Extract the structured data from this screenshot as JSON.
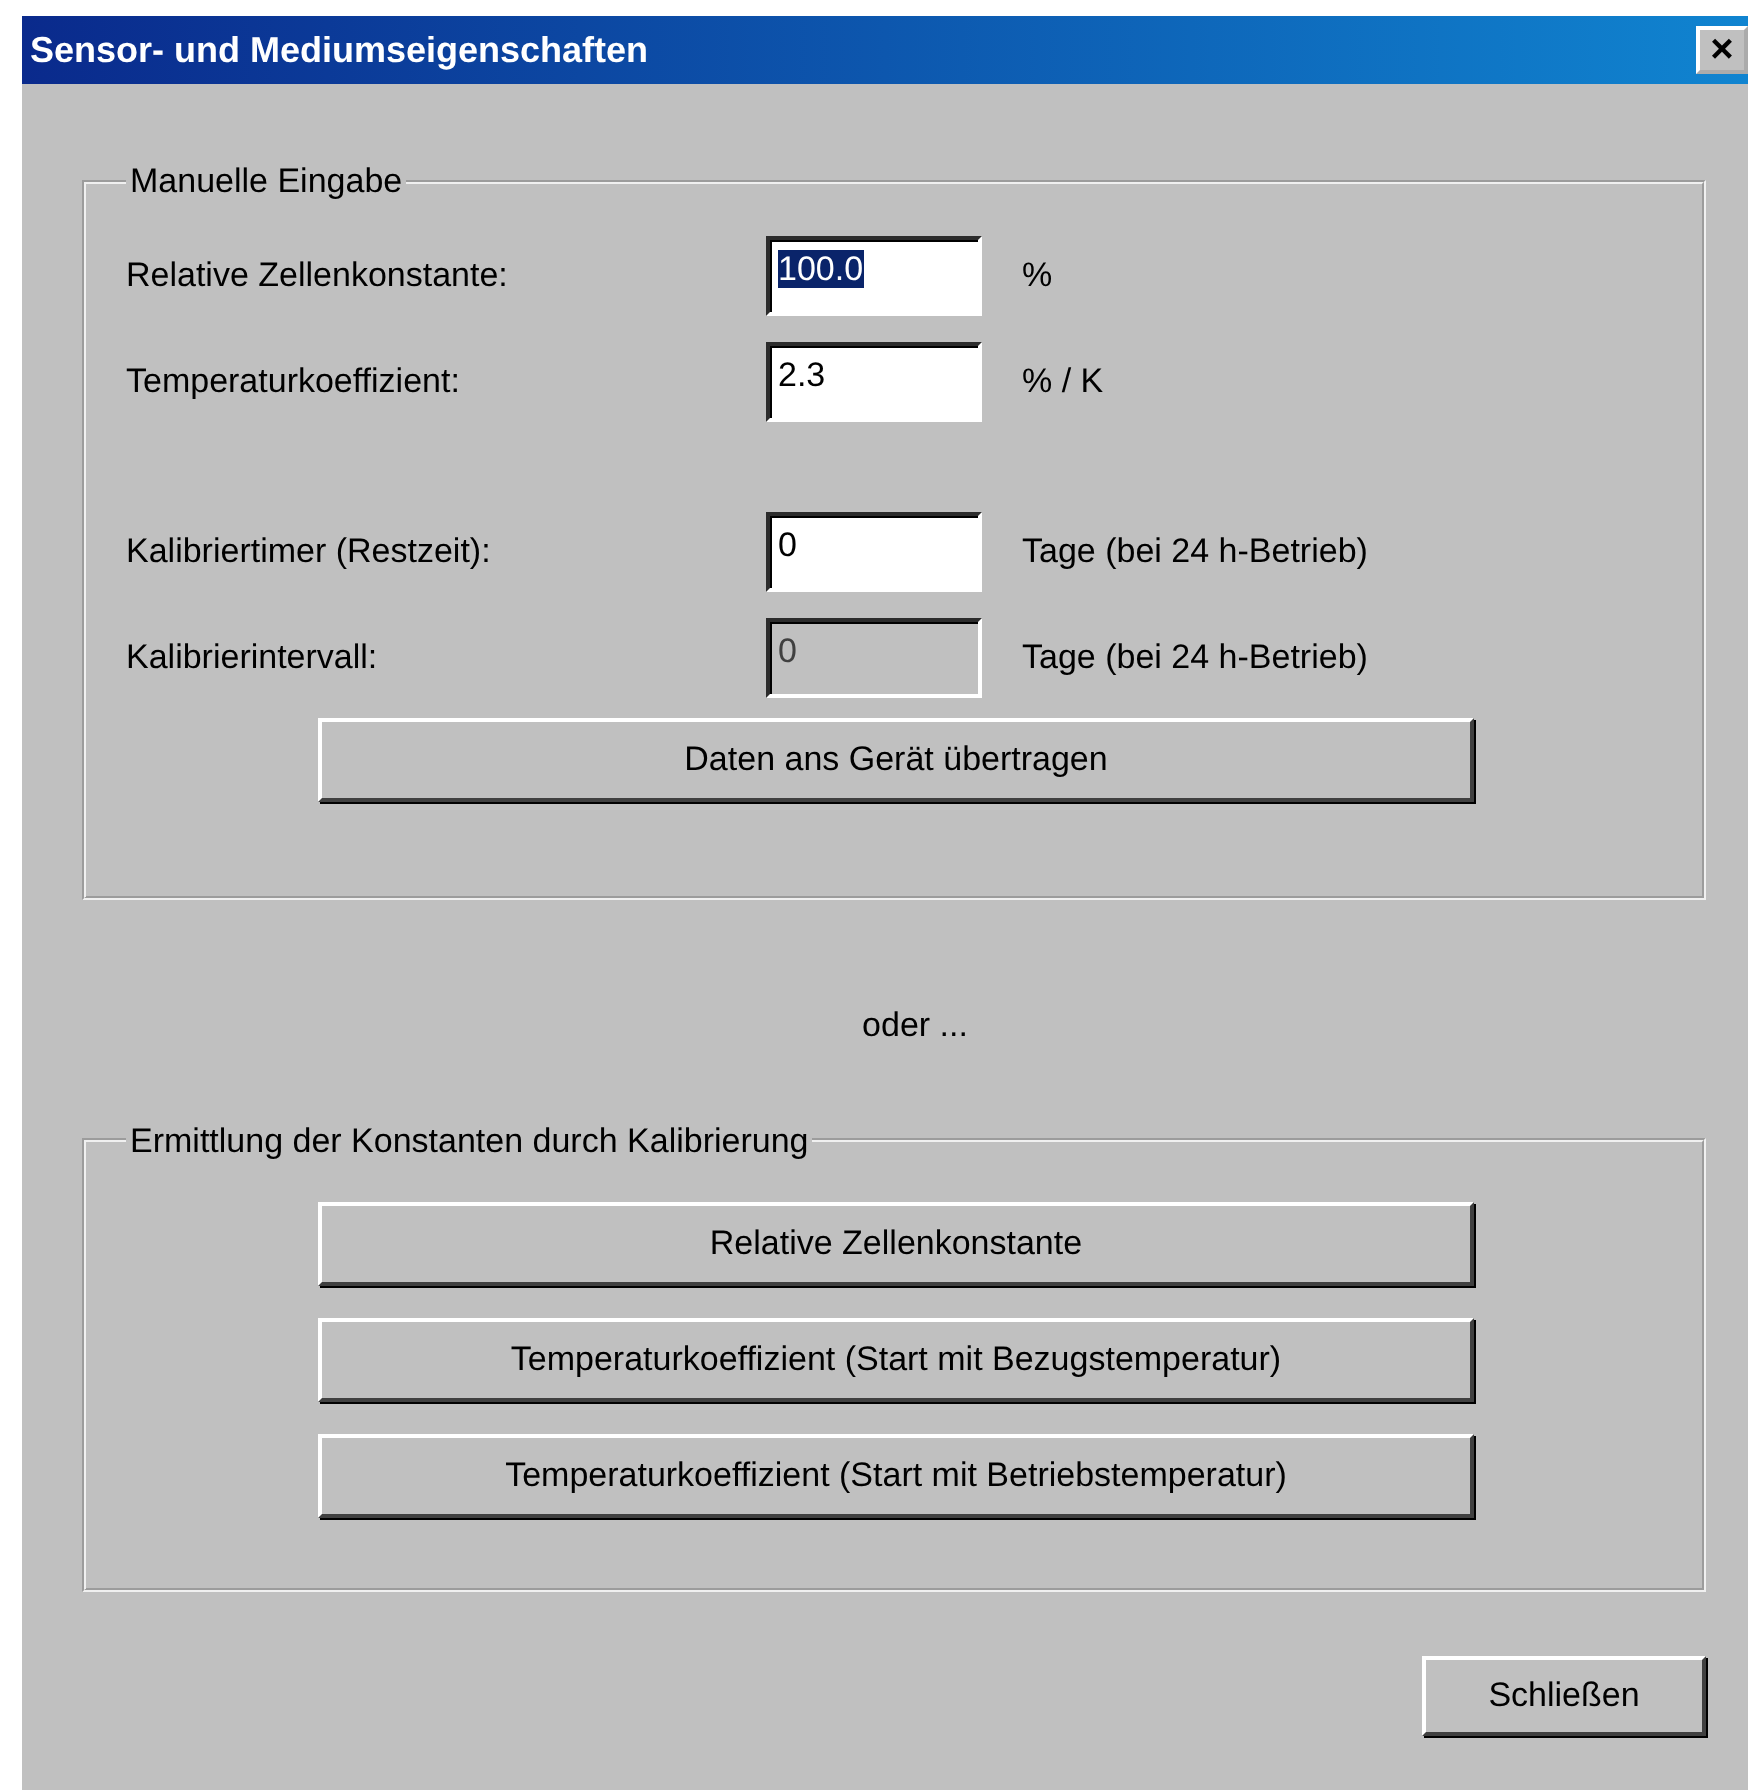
{
  "window": {
    "title": "Sensor- und Mediumseigenschaften",
    "close": "×"
  },
  "manual_group": {
    "title": "Manuelle Eingabe",
    "fields": [
      {
        "label": "Relative Zellenkonstante:",
        "value": "100.0",
        "unit": "%",
        "disabled": false,
        "selected": true
      },
      {
        "label": "Temperaturkoeffizient:",
        "value": "2.3",
        "unit": "% / K",
        "disabled": false,
        "selected": false
      },
      {
        "label": "Kalibriertimer (Restzeit):",
        "value": "0",
        "unit": "Tage (bei 24 h-Betrieb)",
        "disabled": false,
        "selected": false
      },
      {
        "label": "Kalibrierintervall:",
        "value": "0",
        "unit": "Tage (bei 24 h-Betrieb)",
        "disabled": true,
        "selected": false
      }
    ],
    "button": "Daten ans Gerät übertragen"
  },
  "separator_text": "oder ...",
  "calibration_group": {
    "title": "Ermittlung der Konstanten durch Kalibrierung",
    "buttons": [
      "Relative Zellenkonstante",
      "Temperaturkoeffizient (Start mit Bezugstemperatur)",
      "Temperaturkoeffizient (Start mit Betriebstemperatur)"
    ]
  },
  "close_button": "Schließen"
}
